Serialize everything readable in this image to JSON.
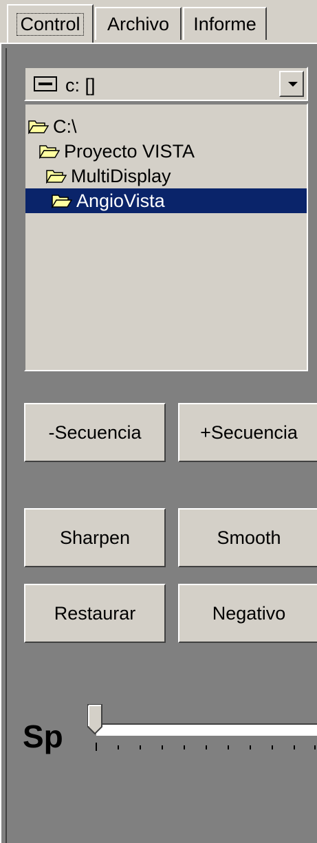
{
  "tabs": [
    {
      "label": "Control",
      "active": true
    },
    {
      "label": "Archivo",
      "active": false
    },
    {
      "label": "Informe",
      "active": false
    }
  ],
  "drive": {
    "label": "c: []",
    "icon": "drive-icon"
  },
  "directories": [
    {
      "label": "C:\\",
      "selected": false
    },
    {
      "label": "Proyecto VISTA",
      "selected": false
    },
    {
      "label": "MultiDisplay",
      "selected": false
    },
    {
      "label": "AngioVista",
      "selected": true
    }
  ],
  "buttons": {
    "prev_seq": "-Secuencia",
    "next_seq": "+Secuencia",
    "sharpen": "Sharpen",
    "smooth": "Smooth",
    "restore": "Restaurar",
    "negative": "Negativo"
  },
  "slider": {
    "label": "Sp",
    "value": 0
  },
  "colors": {
    "selection": "#0a246a",
    "face": "#d4d0c8",
    "background": "#808080"
  }
}
